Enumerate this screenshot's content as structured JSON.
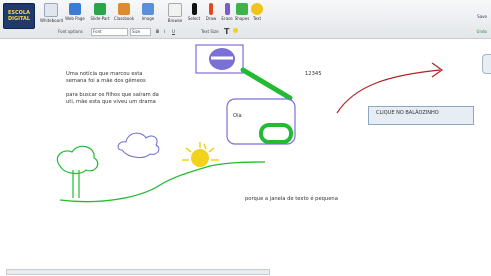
{
  "app": {
    "logo_text": "ESCOLA DIGITAL"
  },
  "toolbar": {
    "tools": [
      "Whiteboard",
      "Web Page",
      "Slide-Part",
      "Classbook",
      "Image",
      "Browse",
      "Select",
      "Draw",
      "Erase",
      "Shapes",
      "Text"
    ],
    "sub_items": [
      "Font options",
      "Font",
      "Size",
      "Text Size"
    ],
    "right_label": "Save",
    "undo_label": "Undo"
  },
  "canvas": {
    "text_block_1": [
      "Uma notícia que marcou esta",
      "semana foi a mãe dos gêmeos"
    ],
    "text_block_2": [
      "para buscar os filhos que saíram da",
      "uti, mãe esta que viveu um drama"
    ],
    "number_label": "12345",
    "box_label": "Ola",
    "note_label": "CLIQUE NO BALÃOZINHO",
    "caption": "porque a janela de texto é pequena"
  },
  "colors": {
    "green": "#22bb33",
    "purple": "#7b70d6",
    "red": "#b22222",
    "yellow": "#f2d21b",
    "blue_cloud": "#6a6fd0"
  }
}
